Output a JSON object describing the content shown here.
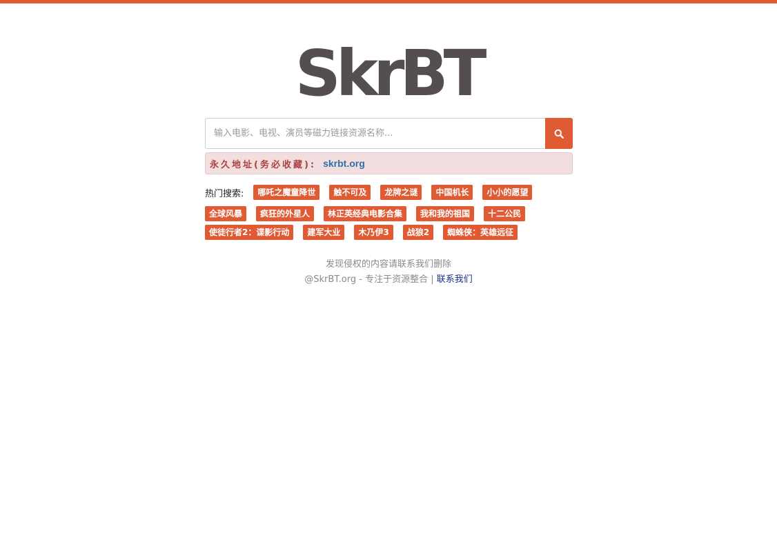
{
  "theme": {
    "accent": "#e05a33",
    "logo_color": "#554e50",
    "notice_bg": "#f2dede",
    "notice_text": "#a94442",
    "link_color": "#2f6fae"
  },
  "logo": {
    "text": "SkrBT"
  },
  "search": {
    "placeholder": "输入电影、电视、演员等磁力链接资源名称...",
    "value": "",
    "button_icon": "search-icon"
  },
  "notice": {
    "label": "永久地址(务必收藏):",
    "link": "skrbt.org"
  },
  "hot": {
    "label": "热门搜索:",
    "rows": [
      [
        "哪吒之魔童降世",
        "触不可及",
        "龙牌之谜",
        "中国机长",
        "小小的愿望"
      ],
      [
        "全球风暴",
        "疯狂的外星人",
        "林正英经典电影合集",
        "我和我的祖国",
        "十二公民"
      ],
      [
        "使徒行者2：谍影行动",
        "建军大业",
        "木乃伊3",
        "战狼2",
        "蜘蛛侠：英雄远征"
      ]
    ]
  },
  "footer": {
    "line1": "发现侵权的内容请联系我们删除",
    "line2_prefix": "@SkrBT.org - 专注于资源整合 | ",
    "contact": "联系我们"
  }
}
